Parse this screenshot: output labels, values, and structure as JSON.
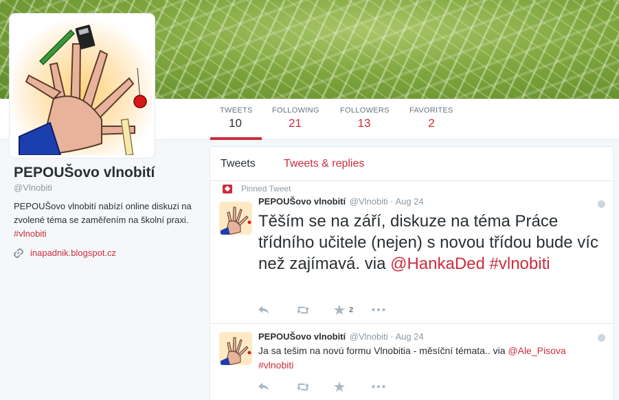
{
  "colors": {
    "accent": "#cc2c3b",
    "muted": "#8899a6",
    "text": "#292f33"
  },
  "nav": [
    {
      "label": "TWEETS",
      "value": "10"
    },
    {
      "label": "FOLLOWING",
      "value": "21"
    },
    {
      "label": "FOLLOWERS",
      "value": "13"
    },
    {
      "label": "FAVORITES",
      "value": "2"
    }
  ],
  "profile": {
    "name": "PEPOUŠovo vlnobití",
    "handle": "@Vlnobiti",
    "bio": "PEPOUŠovo vlnobití nabízí online diskuzi na zvolené téma se zaměřením na školní praxi.",
    "bio_tag": "#vlnobiti",
    "link": "inapadnik.blogspot.cz",
    "link_icon": "link-icon"
  },
  "timeline": {
    "tabs": [
      "Tweets",
      "Tweets & replies"
    ],
    "tweets": [
      {
        "pinned_label": "Pinned Tweet",
        "name": "PEPOUŠovo vlnobití",
        "handle": "@Vlnobiti",
        "date": "· Aug 24",
        "text": "Těším se na září, diskuze na téma Práce třídního učitele (nejen) s novou třídou bude víc než zajímavá. via",
        "mention": "@HankaDed",
        "hashtag": "#vlnobiti",
        "favorites": "2"
      },
      {
        "name": "PEPOUŠovo vlnobití",
        "handle": "@Vlnobiti",
        "date": "· Aug 24",
        "text": "Ja sa tešim na novú formu Vlnobitia - měsíční témata..  via",
        "mention": "@Ale_Pisova",
        "hashtag": "#vlnobiti"
      }
    ]
  }
}
